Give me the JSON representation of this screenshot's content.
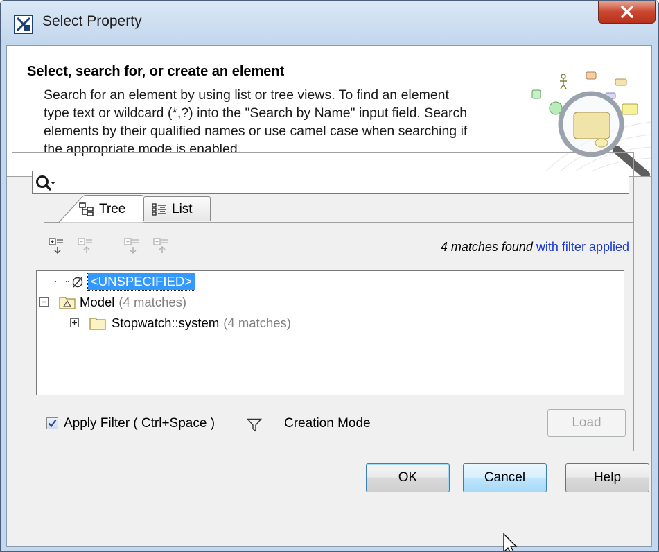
{
  "window": {
    "title": "Select Property"
  },
  "header": {
    "title": "Select, search for, or create an element",
    "description_lines": [
      "Search for an element by using list or tree views. To find an element",
      "type text or wildcard (*,?) into the \"Search by Name\" input field. Search",
      "elements by their qualified names or use camel case when searching if",
      "the appropriate mode is enabled."
    ]
  },
  "search": {
    "value": "",
    "icon": "search-dropdown-icon"
  },
  "tabs": [
    {
      "label": "Tree",
      "icon": "tree-view-icon",
      "active": true
    },
    {
      "label": "List",
      "icon": "list-view-icon",
      "active": false
    }
  ],
  "toolbar": {
    "icons": [
      "expand-all-icon",
      "collapse-all-icon",
      "expand-selected-icon",
      "collapse-selected-icon"
    ]
  },
  "matches": {
    "count_text": "4 matches found",
    "filter_text": "with filter applied"
  },
  "tree": {
    "rows": [
      {
        "label": "<UNSPECIFIED>",
        "count": "",
        "selected": true
      },
      {
        "label": "Model",
        "count": "(4 matches)",
        "selected": false
      },
      {
        "label": "Stopwatch::system",
        "count": "(4 matches)",
        "selected": false
      }
    ]
  },
  "options": {
    "apply_filter_label": "Apply Filter ( Ctrl+Space )",
    "apply_filter_checked": true,
    "creation_mode_label": "Creation Mode",
    "load_label": "Load"
  },
  "buttons": {
    "ok": "OK",
    "cancel": "Cancel",
    "help": "Help"
  },
  "colors": {
    "selection": "#3399ff",
    "link": "#1a37d6",
    "muted": "#808080"
  }
}
